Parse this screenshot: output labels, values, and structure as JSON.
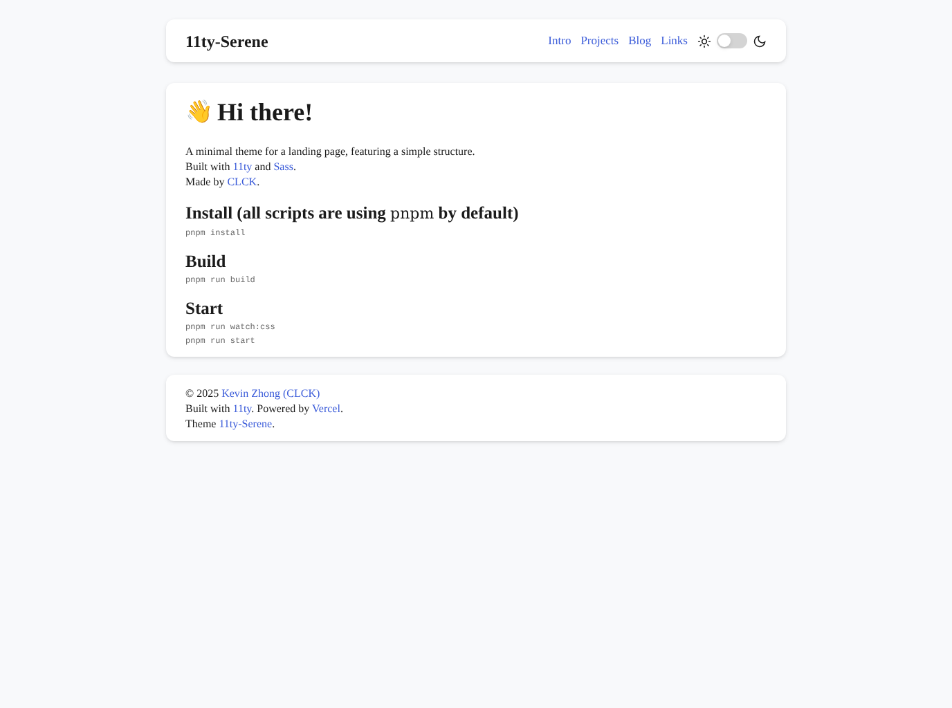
{
  "header": {
    "title": "11ty-Serene",
    "nav": [
      "Intro",
      "Projects",
      "Blog",
      "Links"
    ],
    "theme_toggle": {
      "on": false
    }
  },
  "main": {
    "emoji": "👋",
    "heading": "Hi there!",
    "intro": [
      [
        {
          "kind": "text",
          "text": "A minimal theme for a landing page, featuring a simple structure."
        }
      ],
      [
        {
          "kind": "text",
          "text": "Built with "
        },
        {
          "kind": "link",
          "text": "11ty"
        },
        {
          "kind": "text",
          "text": " and "
        },
        {
          "kind": "link",
          "text": "Sass"
        },
        {
          "kind": "text",
          "text": "."
        }
      ],
      [
        {
          "kind": "text",
          "text": "Made by "
        },
        {
          "kind": "link",
          "text": "CLCK"
        },
        {
          "kind": "text",
          "text": "."
        }
      ]
    ],
    "sections": [
      {
        "heading": [
          {
            "kind": "text",
            "text": "Install (all scripts are using "
          },
          {
            "kind": "code",
            "text": "pnpm"
          },
          {
            "kind": "text",
            "text": " by default)"
          }
        ],
        "commands": [
          "pnpm install"
        ]
      },
      {
        "heading": [
          {
            "kind": "text",
            "text": "Build"
          }
        ],
        "commands": [
          "pnpm run build"
        ]
      },
      {
        "heading": [
          {
            "kind": "text",
            "text": "Start"
          }
        ],
        "commands": [
          "pnpm run watch:css",
          "pnpm run start"
        ]
      }
    ]
  },
  "footer": [
    [
      {
        "kind": "text",
        "text": "© 2025 "
      },
      {
        "kind": "link",
        "text": "Kevin Zhong (CLCK)"
      }
    ],
    [
      {
        "kind": "text",
        "text": "Built with "
      },
      {
        "kind": "link",
        "text": "11ty"
      },
      {
        "kind": "text",
        "text": ". Powered by "
      },
      {
        "kind": "link",
        "text": "Vercel"
      },
      {
        "kind": "text",
        "text": "."
      }
    ],
    [
      {
        "kind": "text",
        "text": "Theme "
      },
      {
        "kind": "link",
        "text": "11ty-Serene"
      },
      {
        "kind": "text",
        "text": "."
      }
    ]
  ]
}
